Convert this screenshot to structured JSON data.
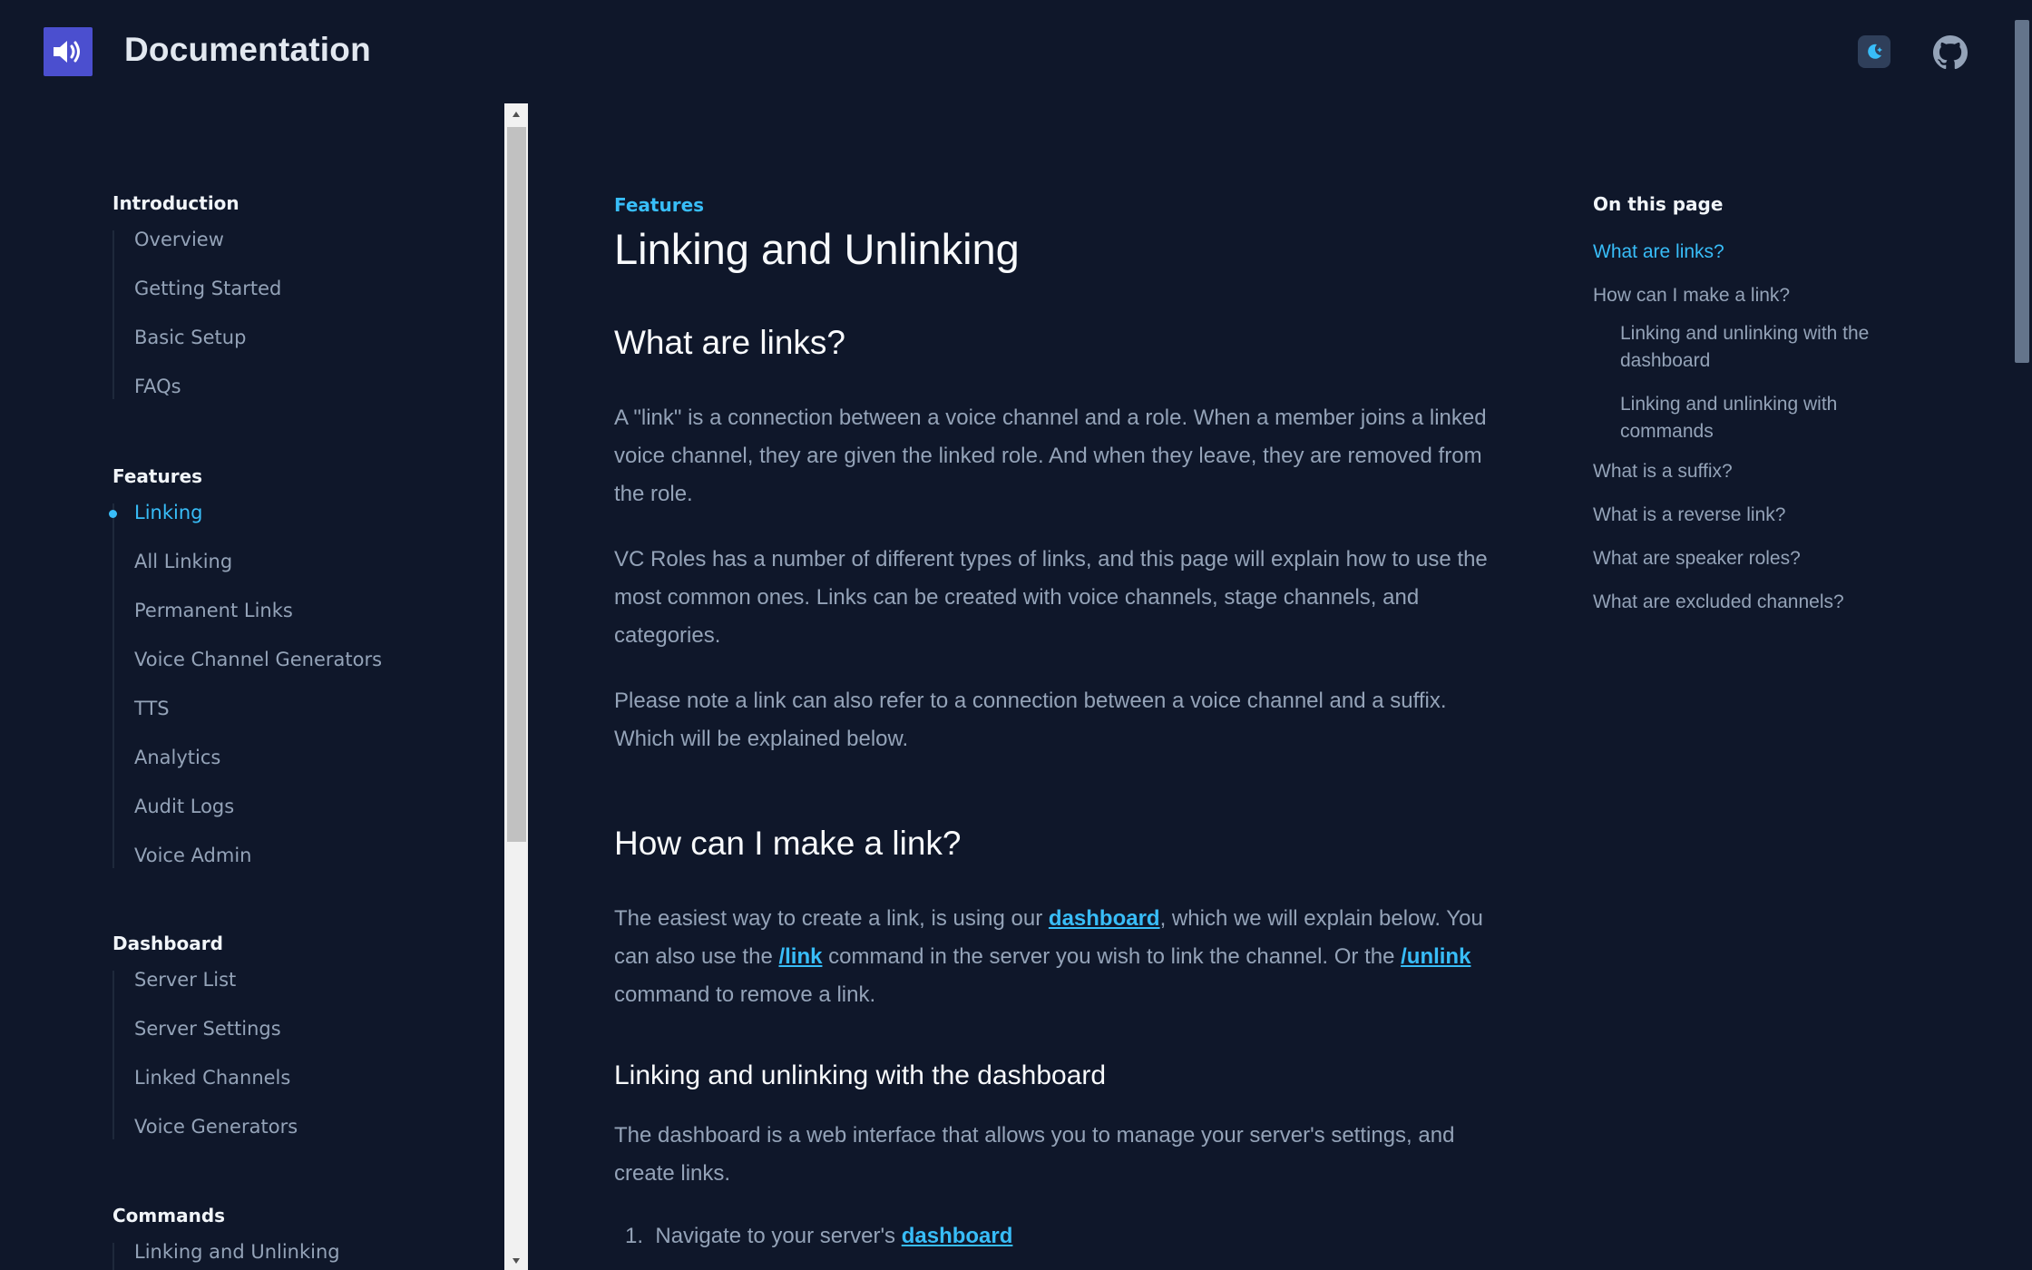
{
  "header": {
    "site_title": "Documentation",
    "logo_icon": "speaker-icon",
    "theme_icon": "moon-icon",
    "github_icon": "github-icon"
  },
  "sidebar": {
    "sections": [
      {
        "heading": "Introduction",
        "items": [
          {
            "label": "Overview",
            "active": false
          },
          {
            "label": "Getting Started",
            "active": false
          },
          {
            "label": "Basic Setup",
            "active": false
          },
          {
            "label": "FAQs",
            "active": false
          }
        ]
      },
      {
        "heading": "Features",
        "items": [
          {
            "label": "Linking",
            "active": true
          },
          {
            "label": "All Linking",
            "active": false
          },
          {
            "label": "Permanent Links",
            "active": false
          },
          {
            "label": "Voice Channel Generators",
            "active": false
          },
          {
            "label": "TTS",
            "active": false
          },
          {
            "label": "Analytics",
            "active": false
          },
          {
            "label": "Audit Logs",
            "active": false
          },
          {
            "label": "Voice Admin",
            "active": false
          }
        ]
      },
      {
        "heading": "Dashboard",
        "items": [
          {
            "label": "Server List",
            "active": false
          },
          {
            "label": "Server Settings",
            "active": false
          },
          {
            "label": "Linked Channels",
            "active": false
          },
          {
            "label": "Voice Generators",
            "active": false
          }
        ]
      },
      {
        "heading": "Commands",
        "items": [
          {
            "label": "Linking and Unlinking",
            "active": false
          }
        ]
      }
    ]
  },
  "main": {
    "eyebrow": "Features",
    "title": "Linking and Unlinking",
    "h2_links": "What are links?",
    "p1": "A \"link\" is a connection between a voice channel and a role. When a member joins a linked voice channel, they are given the linked role. And when they leave, they are removed from the role.",
    "p2": "VC Roles has a number of different types of links, and this page will explain how to use the most common ones. Links can be created with voice channels, stage channels, and categories.",
    "p3": "Please note a link can also refer to a connection between a voice channel and a suffix. Which will be explained below.",
    "h2_make": "How can I make a link?",
    "p4_a": "The easiest way to create a link, is using our ",
    "p4_link1": "dashboard",
    "p4_b": ", which we will explain below. You can also use the ",
    "p4_link2": "/link",
    "p4_c": " command in the server you wish to link the channel. Or the ",
    "p4_link3": "/unlink",
    "p4_d": " command to remove a link.",
    "h3_dashboard": "Linking and unlinking with the dashboard",
    "p5": "The dashboard is a web interface that allows you to manage your server's settings, and create links.",
    "list1_num": "1.",
    "list1_text": "Navigate to your server's ",
    "list1_link": "dashboard"
  },
  "toc": {
    "heading": "On this page",
    "items": [
      {
        "label": "What are links?",
        "active": true,
        "sub": false
      },
      {
        "label": "How can I make a link?",
        "active": false,
        "sub": false
      },
      {
        "label": "Linking and unlinking with the dashboard",
        "active": false,
        "sub": true
      },
      {
        "label": "Linking and unlinking with commands",
        "active": false,
        "sub": true
      },
      {
        "label": "What is a suffix?",
        "active": false,
        "sub": false
      },
      {
        "label": "What is a reverse link?",
        "active": false,
        "sub": false
      },
      {
        "label": "What are speaker roles?",
        "active": false,
        "sub": false
      },
      {
        "label": "What are excluded channels?",
        "active": false,
        "sub": false
      }
    ]
  },
  "colors": {
    "background": "#0f172a",
    "accent": "#38bdf8",
    "logo_bg": "#4b4fcf",
    "text": "#94a3b8",
    "heading": "#f8fafc"
  }
}
